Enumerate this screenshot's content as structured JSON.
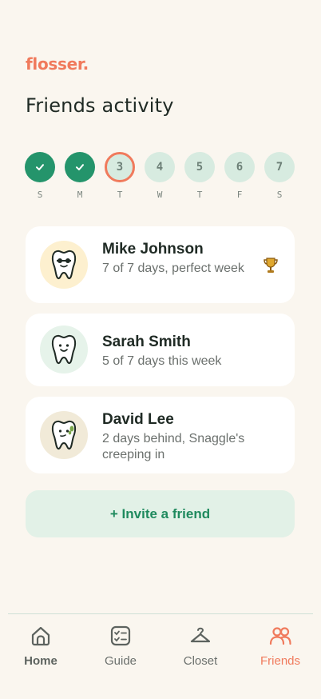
{
  "app": {
    "logo": "flosser."
  },
  "page": {
    "title": "Friends activity"
  },
  "week": {
    "days": [
      {
        "number": "",
        "letter": "S",
        "state": "done"
      },
      {
        "number": "",
        "letter": "M",
        "state": "done"
      },
      {
        "number": "3",
        "letter": "T",
        "state": "today"
      },
      {
        "number": "4",
        "letter": "W",
        "state": "upcoming"
      },
      {
        "number": "5",
        "letter": "T",
        "state": "upcoming"
      },
      {
        "number": "6",
        "letter": "F",
        "state": "upcoming"
      },
      {
        "number": "7",
        "letter": "S",
        "state": "upcoming"
      }
    ]
  },
  "friends": [
    {
      "name": "Mike Johnson",
      "status": "7 of 7 days, perfect week",
      "avatar_bg": "#fdf0cf",
      "badge": "trophy-icon"
    },
    {
      "name": "Sarah Smith",
      "status": "5 of 7 days this week",
      "avatar_bg": "#e6f3ea"
    },
    {
      "name": "David Lee",
      "status": "2 days behind, Snaggle's creeping in",
      "avatar_bg": "#f1ead8"
    }
  ],
  "invite": {
    "label": "+ Invite a friend"
  },
  "nav": {
    "items": [
      {
        "label": "Home",
        "icon": "home-icon"
      },
      {
        "label": "Guide",
        "icon": "checklist-icon"
      },
      {
        "label": "Closet",
        "icon": "hanger-icon"
      },
      {
        "label": "Friends",
        "icon": "friends-icon"
      }
    ],
    "active": "Friends"
  },
  "colors": {
    "accent": "#f07a5c",
    "green": "#24946b",
    "background": "#faf6ef"
  }
}
